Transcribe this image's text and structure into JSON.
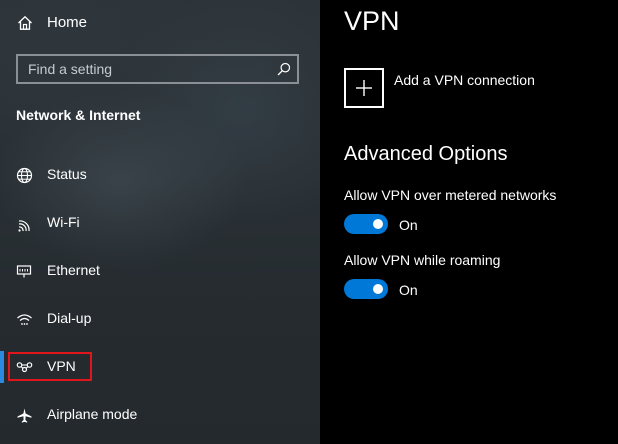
{
  "sidebar": {
    "home_label": "Home",
    "search_placeholder": "Find a setting",
    "section_title": "Network & Internet",
    "items": [
      {
        "label": "Status",
        "icon": "globe-icon"
      },
      {
        "label": "Wi-Fi",
        "icon": "wifi-icon"
      },
      {
        "label": "Ethernet",
        "icon": "ethernet-icon"
      },
      {
        "label": "Dial-up",
        "icon": "dial-up-icon"
      },
      {
        "label": "VPN",
        "icon": "vpn-icon",
        "selected": true
      },
      {
        "label": "Airplane mode",
        "icon": "airplane-icon"
      }
    ]
  },
  "main": {
    "title": "VPN",
    "add_vpn_label": "Add a VPN connection",
    "advanced_title": "Advanced Options",
    "options": [
      {
        "label": "Allow VPN over metered networks",
        "state": "On",
        "on": true
      },
      {
        "label": "Allow VPN while roaming",
        "state": "On",
        "on": true
      }
    ]
  },
  "colors": {
    "accent": "#0078d7",
    "selection_bar": "#2b8ae0",
    "highlight_box": "#e0161c"
  }
}
